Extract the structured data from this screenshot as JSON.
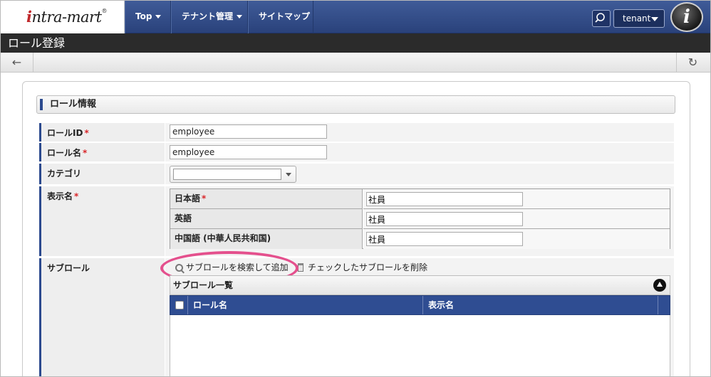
{
  "header": {
    "logo_text_i": "i",
    "logo_text_rest": "ntra-mart",
    "logo_reg": "®",
    "nav": [
      {
        "label": "Top"
      },
      {
        "label": "テナント管理"
      },
      {
        "label": "サイトマップ"
      }
    ],
    "tenant_label": "tenant",
    "avatar_letter": "i"
  },
  "page": {
    "title": "ロール登録",
    "back_icon": "←",
    "reload_icon": "↻"
  },
  "section": {
    "title": "ロール情報"
  },
  "form": {
    "required_mark": "*",
    "role_id": {
      "label": "ロールID",
      "value": "employee"
    },
    "role_name": {
      "label": "ロール名",
      "value": "employee"
    },
    "category": {
      "label": "カテゴリ",
      "value": ""
    },
    "display_name": {
      "label": "表示名",
      "rows": [
        {
          "label": "日本語",
          "required": true,
          "value": "社員"
        },
        {
          "label": "英語",
          "required": false,
          "value": "社員"
        },
        {
          "label": "中国語 (中華人民共和国)",
          "required": false,
          "value": "社員"
        }
      ]
    },
    "sub_role": {
      "label": "サブロール",
      "search_add": "サブロールを検索して追加",
      "delete_checked": "チェックしたサブロールを削除",
      "list_title": "サブロール一覧",
      "columns": [
        "ロール名",
        "表示名"
      ]
    }
  },
  "colors": {
    "header_bg": "#2a427b",
    "accent": "#2c4a8e",
    "required": "#d9262a",
    "highlight": "#e4508d"
  }
}
